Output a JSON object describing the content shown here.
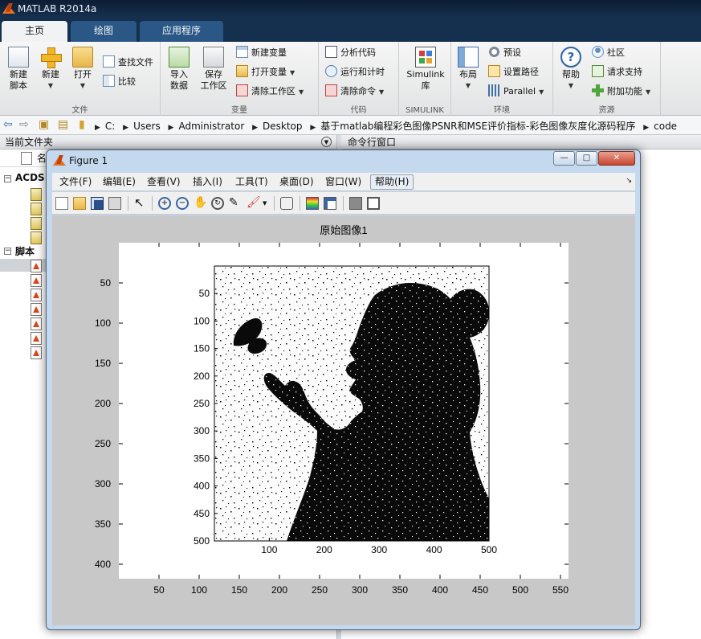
{
  "window": {
    "title": "MATLAB R2014a"
  },
  "tabs": [
    {
      "label": "主页"
    },
    {
      "label": "绘图"
    },
    {
      "label": "应用程序"
    }
  ],
  "ribbon": {
    "file": {
      "label": "文件",
      "new_script": "新建\n脚本",
      "new": "新建",
      "open": "打开",
      "find_files": "查找文件",
      "compare": "比较"
    },
    "variable": {
      "label": "变量",
      "import": "导入\n数据",
      "save_ws": "保存\n工作区",
      "new_var": "新建变量",
      "open_var": "打开变量",
      "clear_ws": "清除工作区"
    },
    "code": {
      "label": "代码",
      "analyze": "分析代码",
      "run_time": "运行和计时",
      "clear_cmd": "清除命令"
    },
    "simulink": {
      "label": "SIMULINK",
      "lib": "Simulink\n库"
    },
    "env": {
      "label": "环境",
      "layout": "布局",
      "prefs": "预设",
      "set_path": "设置路径",
      "parallel": "Parallel"
    },
    "resources": {
      "label": "资源",
      "help": "帮助",
      "community": "社区",
      "support": "请求支持",
      "addons": "附加功能"
    }
  },
  "address": {
    "crumbs": [
      "C:",
      "Users",
      "Administrator",
      "Desktop",
      "基于matlab编程彩色图像PSNR和MSE评价指标-彩色图像灰度化源码程序",
      "code"
    ]
  },
  "left_panel": {
    "title": "当前文件夹",
    "column": "名",
    "folder1": "ACDS",
    "folder2": "脚本"
  },
  "right_panel": {
    "title": "命令行窗口"
  },
  "figure": {
    "title": "Figure 1",
    "menu": [
      "文件(F)",
      "编辑(E)",
      "查看(V)",
      "插入(I)",
      "工具(T)",
      "桌面(D)",
      "窗口(W)",
      "帮助(H)"
    ],
    "plot_title": "原始图像1"
  },
  "chart_data": {
    "type": "image",
    "title": "原始图像1",
    "outer_axes": {
      "xticks": [
        50,
        100,
        150,
        200,
        250,
        300,
        350,
        400,
        450,
        500,
        550
      ],
      "yticks": [
        50,
        100,
        150,
        200,
        250,
        300,
        350,
        400
      ]
    },
    "inner_axes": {
      "xticks": [
        100,
        200,
        300,
        400,
        500
      ],
      "yticks": [
        50,
        100,
        150,
        200,
        250,
        300,
        350,
        400,
        450,
        500
      ]
    }
  },
  "colors": {
    "titlebar": "#0d1d33",
    "tab_active": "#f1f2f3",
    "tab_inactive": "#2a5785"
  }
}
